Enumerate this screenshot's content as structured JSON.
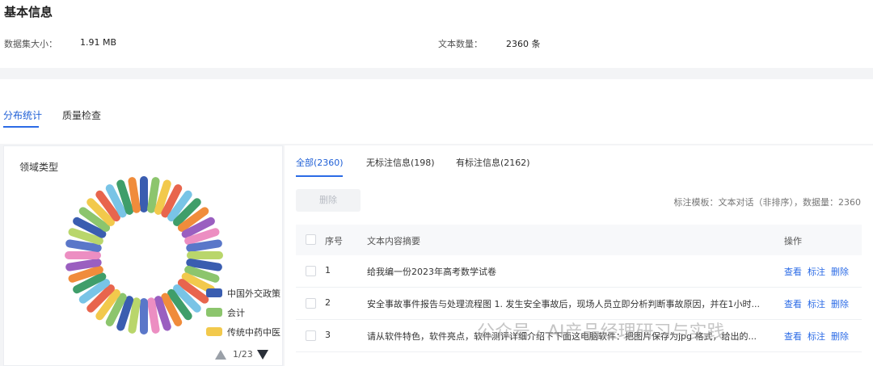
{
  "section_title": "基本信息",
  "info": {
    "size_label": "数据集大小：",
    "size_value": "1.91 MB",
    "count_label": "文本数量：",
    "count_value": "2360 条"
  },
  "top_tabs": [
    "分布统计",
    "质量检查"
  ],
  "left_panel": {
    "title": "领域类型",
    "legend": [
      {
        "label": "中国外交政策",
        "color": "#3a5db0"
      },
      {
        "label": "会计",
        "color": "#8cc56d"
      },
      {
        "label": "传统中药中医",
        "color": "#f2c94c"
      }
    ],
    "pager_text": "1/23",
    "pager_up_icon": "triangle-up-icon",
    "pager_down_icon": "triangle-down-icon"
  },
  "sub_tabs": [
    "全部(2360)",
    "无标注信息(198)",
    "有标注信息(2162)"
  ],
  "delete_button": "删除",
  "meta_text": "标注模板：文本对话（非排序），数据量：2360",
  "table": {
    "headers": [
      "序号",
      "文本内容摘要",
      "操作"
    ],
    "rows": [
      {
        "index": "1",
        "summary": "给我编一份2023年高考数学试卷"
      },
      {
        "index": "2",
        "summary": "安全事故事件报告与处理流程图 1. 发生安全事故后，现场人员立即分析判断事故原因，并在1小时..."
      },
      {
        "index": "3",
        "summary": "请从软件特色，软件亮点，软件测评详细介绍下下面这电脑软件：把图片保存为jpg 格式，给出的..."
      }
    ],
    "actions": [
      "查看",
      "标注",
      "删除"
    ]
  },
  "watermark": "公众号 · AI产品经理研习与实践",
  "chart_data": {
    "type": "pie",
    "style": "donut",
    "categories": [
      "中国外交政策",
      "会计",
      "传统中药中医"
    ],
    "values": [],
    "colors": [
      "#3a5db0",
      "#8cc56d",
      "#f2c94c",
      "#e8654d",
      "#79c4e6",
      "#3f9e6a",
      "#f08c3b",
      "#9a5fc0",
      "#ec8ec2",
      "#5a77c9",
      "#b9d66b"
    ]
  }
}
